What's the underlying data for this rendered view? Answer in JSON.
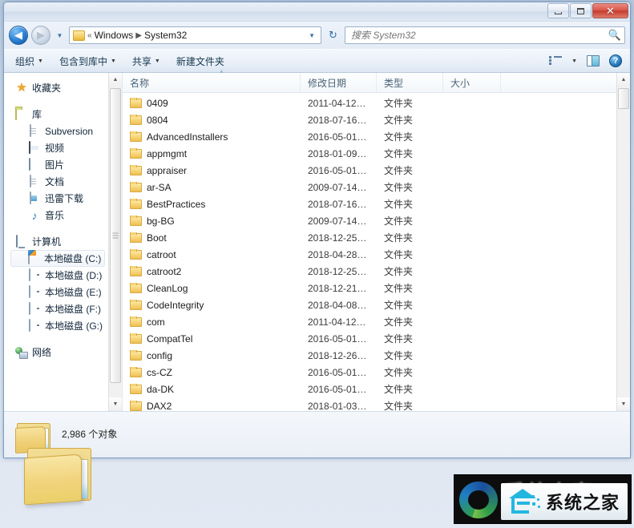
{
  "window": {
    "controls": {
      "minimize": "−",
      "maximize": "□",
      "close": "✕"
    }
  },
  "address": {
    "back_icon": "◀",
    "forward_icon": "▶",
    "history_caret": "▼",
    "breadcrumb_prefix": "«",
    "crumbs": [
      "Windows",
      "System32"
    ],
    "separator": "▶",
    "dropdown_caret": "▼",
    "refresh_icon": "↻"
  },
  "search": {
    "placeholder": "搜索 System32",
    "value": "",
    "icon": "search-icon"
  },
  "toolbar": {
    "organize": "组织",
    "include_in_library": "包含到库中",
    "share": "共享",
    "new_folder": "新建文件夹",
    "caret": "▼",
    "view_icon": "view-list-icon",
    "preview_pane_icon": "preview-pane-icon",
    "help_icon": "?"
  },
  "sidebar": {
    "favorites": {
      "label": "收藏夹",
      "icon": "star-icon"
    },
    "library": {
      "label": "库",
      "icon": "library-folder-icon"
    },
    "library_items": [
      {
        "label": "Subversion",
        "icon": "document-icon"
      },
      {
        "label": "视频",
        "icon": "video-icon"
      },
      {
        "label": "图片",
        "icon": "picture-icon"
      },
      {
        "label": "文档",
        "icon": "document-icon"
      },
      {
        "label": "迅雷下载",
        "icon": "download-icon"
      },
      {
        "label": "音乐",
        "icon": "music-icon"
      }
    ],
    "computer": {
      "label": "计算机",
      "icon": "computer-icon"
    },
    "drives": [
      {
        "label": "本地磁盘 (C:)",
        "icon": "system-drive-icon",
        "selected": true
      },
      {
        "label": "本地磁盘 (D:)",
        "icon": "drive-icon",
        "selected": false
      },
      {
        "label": "本地磁盘 (E:)",
        "icon": "drive-icon",
        "selected": false
      },
      {
        "label": "本地磁盘 (F:)",
        "icon": "drive-icon",
        "selected": false
      },
      {
        "label": "本地磁盘 (G:)",
        "icon": "drive-icon",
        "selected": false
      }
    ],
    "network": {
      "label": "网络",
      "icon": "network-icon"
    },
    "scroll_up": "▲",
    "scroll_down": "▼"
  },
  "filelist": {
    "columns": {
      "name": "名称",
      "date_modified": "修改日期",
      "type": "类型",
      "size": "大小"
    },
    "sort_indicator": "▲",
    "scroll_up": "▲",
    "scroll_down": "▼",
    "rows": [
      {
        "name": "0409",
        "date": "2011-04-12…",
        "type": "文件夹",
        "size": ""
      },
      {
        "name": "0804",
        "date": "2018-07-16…",
        "type": "文件夹",
        "size": ""
      },
      {
        "name": "AdvancedInstallers",
        "date": "2016-05-01…",
        "type": "文件夹",
        "size": ""
      },
      {
        "name": "appmgmt",
        "date": "2018-01-09…",
        "type": "文件夹",
        "size": ""
      },
      {
        "name": "appraiser",
        "date": "2016-05-01…",
        "type": "文件夹",
        "size": ""
      },
      {
        "name": "ar-SA",
        "date": "2009-07-14…",
        "type": "文件夹",
        "size": ""
      },
      {
        "name": "BestPractices",
        "date": "2018-07-16…",
        "type": "文件夹",
        "size": ""
      },
      {
        "name": "bg-BG",
        "date": "2009-07-14…",
        "type": "文件夹",
        "size": ""
      },
      {
        "name": "Boot",
        "date": "2018-12-25…",
        "type": "文件夹",
        "size": ""
      },
      {
        "name": "catroot",
        "date": "2018-04-28…",
        "type": "文件夹",
        "size": ""
      },
      {
        "name": "catroot2",
        "date": "2018-12-25…",
        "type": "文件夹",
        "size": ""
      },
      {
        "name": "CleanLog",
        "date": "2018-12-21…",
        "type": "文件夹",
        "size": ""
      },
      {
        "name": "CodeIntegrity",
        "date": "2018-04-08…",
        "type": "文件夹",
        "size": ""
      },
      {
        "name": "com",
        "date": "2011-04-12…",
        "type": "文件夹",
        "size": ""
      },
      {
        "name": "CompatTel",
        "date": "2016-05-01…",
        "type": "文件夹",
        "size": ""
      },
      {
        "name": "config",
        "date": "2018-12-26…",
        "type": "文件夹",
        "size": ""
      },
      {
        "name": "cs-CZ",
        "date": "2016-05-01…",
        "type": "文件夹",
        "size": ""
      },
      {
        "name": "da-DK",
        "date": "2016-05-01…",
        "type": "文件夹",
        "size": ""
      },
      {
        "name": "DAX2",
        "date": "2018-01-03…",
        "type": "文件夹",
        "size": ""
      }
    ]
  },
  "statusbar": {
    "item_count": "2,986 个对象",
    "folder_icon": "folder-icon"
  },
  "watermark": {
    "text": "系统之家",
    "ghost_text": "系统之家"
  }
}
